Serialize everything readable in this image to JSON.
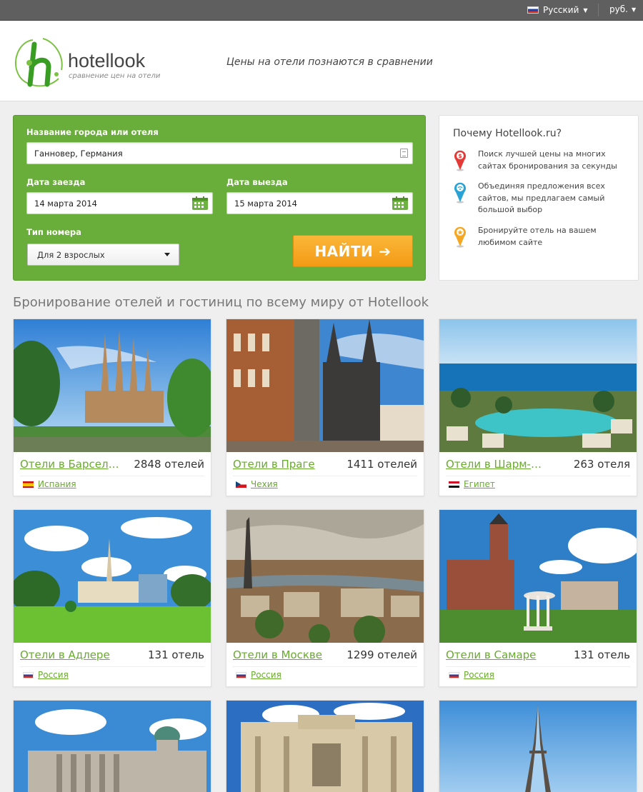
{
  "topbar": {
    "language": "Русский",
    "currency": "руб."
  },
  "header": {
    "logo_name": "hotellook",
    "logo_sub": "сравнение цен на отели",
    "slogan": "Цены на отели познаются в сравнении"
  },
  "search": {
    "city_label": "Название города или отеля",
    "city_value": "Ганновер, Германия",
    "checkin_label": "Дата заезда",
    "checkin_value": "14 марта 2014",
    "checkout_label": "Дата выезда",
    "checkout_value": "15 марта 2014",
    "room_label": "Тип номера",
    "room_value": "Для 2 взрослых",
    "find_button": "НАЙТИ",
    "find_arrow": "➔"
  },
  "why": {
    "title": "Почему Hotellook.ru?",
    "items": [
      {
        "icon": "dollar-pin-icon",
        "color": "#e53935",
        "text": "Поиск лучшей цены на многих сайтах бронирования за секунды"
      },
      {
        "icon": "wifi-pin-icon",
        "color": "#29a3d6",
        "text": "Объединяя предложения всех сайтов, мы предлагаем самый большой выбор"
      },
      {
        "icon": "star-pin-icon",
        "color": "#f5a623",
        "text": "Бронируйте отель на вашем любимом сайте"
      }
    ]
  },
  "section_title": "Бронирование отелей и гостиниц по всему миру от Hotellook",
  "cards": [
    {
      "city": "Отели в Барселоне",
      "count": "2848 отелей",
      "country": "Испания",
      "flag": "es"
    },
    {
      "city": "Отели в Праге",
      "count": "1411 отелей",
      "country": "Чехия",
      "flag": "cz"
    },
    {
      "city": "Отели в Шарм-эль-Шейхе",
      "count": "263 отеля",
      "country": "Египет",
      "flag": "eg"
    },
    {
      "city": "Отели в Адлере",
      "count": "131 отель",
      "country": "Россия",
      "flag": "ru"
    },
    {
      "city": "Отели в Москве",
      "count": "1299 отелей",
      "country": "Россия",
      "flag": "ru"
    },
    {
      "city": "Отели в Самаре",
      "count": "131 отель",
      "country": "Россия",
      "flag": "ru"
    }
  ],
  "colors": {
    "brand_green": "#69ad3a",
    "link_green": "#68ab2d",
    "button_orange": "#f39a14"
  }
}
